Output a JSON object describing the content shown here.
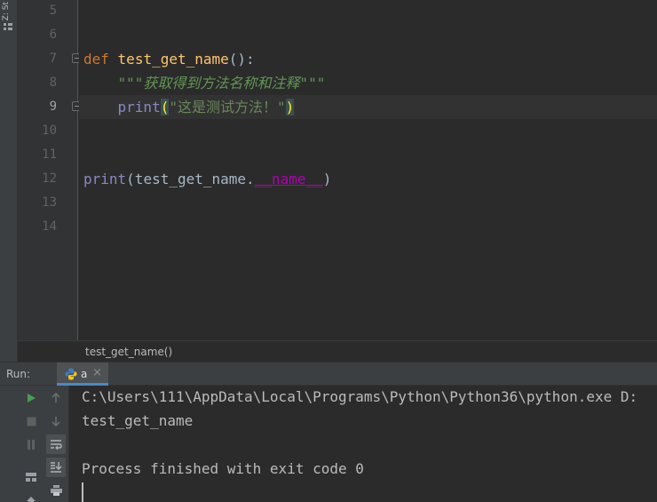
{
  "side_strip": {
    "label": "Z: St"
  },
  "editor": {
    "lines": [
      {
        "num": "5"
      },
      {
        "num": "6"
      },
      {
        "num": "7"
      },
      {
        "num": "8"
      },
      {
        "num": "9"
      },
      {
        "num": "10"
      },
      {
        "num": "11"
      },
      {
        "num": "12"
      },
      {
        "num": "13"
      },
      {
        "num": "14"
      }
    ],
    "code": {
      "def_kw": "def",
      "func_name": "test_get_name",
      "def_tail": "():",
      "docstring": "\"\"\"获取得到方法名称和注释\"\"\"",
      "print_kw": "print",
      "paren_open": "(",
      "string_arg": "\"这是测试方法！\"",
      "paren_close": ")",
      "print2_kw": "print",
      "print2_open": "(test_get_name.",
      "magic_attr": "__name__",
      "print2_close": ")"
    }
  },
  "breadcrumb": "test_get_name()",
  "run_panel": {
    "title": "Run:",
    "tab_label": "a",
    "tab_close": "×",
    "console_lines": [
      "C:\\Users\\111\\AppData\\Local\\Programs\\Python\\Python36\\python.exe D:",
      "test_get_name",
      "",
      "Process finished with exit code 0"
    ]
  },
  "colors": {
    "keyword": "#cc7832",
    "function": "#ffc66d",
    "docstring": "#629755",
    "string": "#6a8759",
    "builtin": "#8888c6",
    "magic": "#b200b2",
    "run_icon": "#499c54"
  },
  "icons": [
    "run-icon",
    "stop-icon",
    "pause-icon",
    "up-arrow-icon",
    "down-arrow-icon",
    "soft-wrap-icon",
    "scroll-to-end-icon",
    "layout-icon",
    "print-icon",
    "pin-icon",
    "python-icon"
  ]
}
